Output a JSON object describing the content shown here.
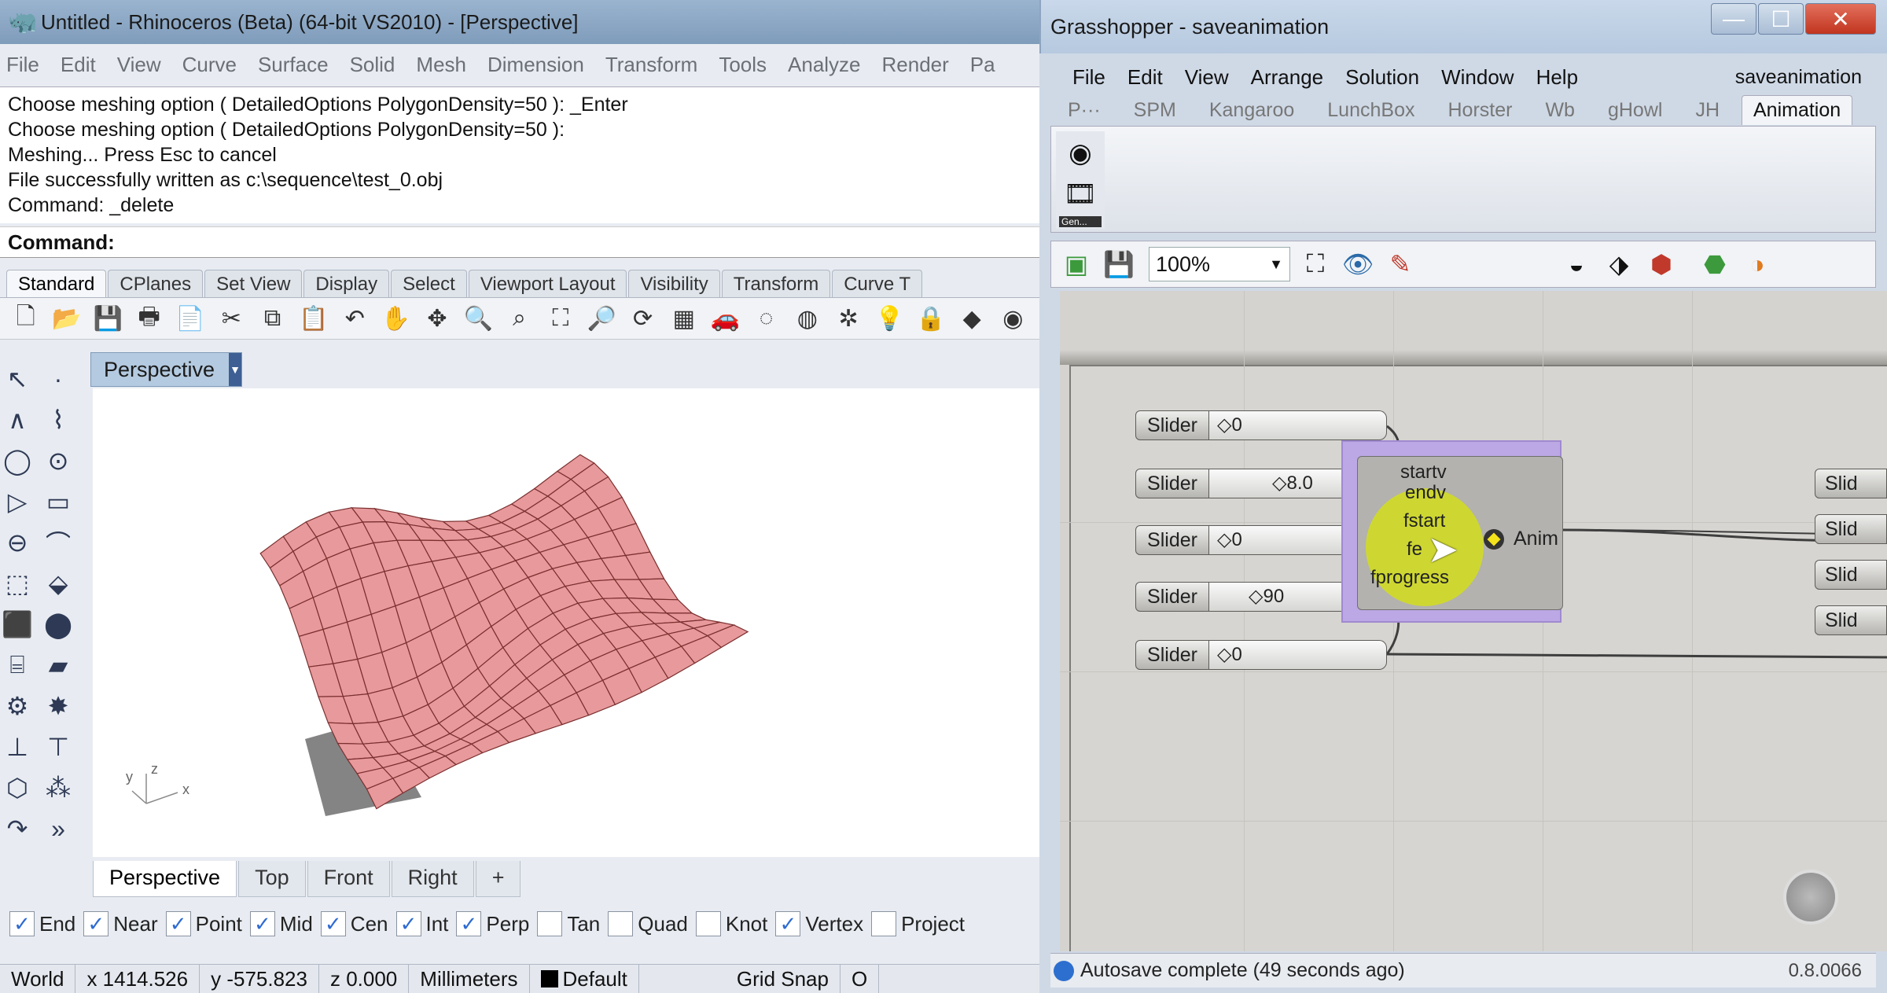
{
  "rhino": {
    "title": "Untitled - Rhinoceros (Beta) (64-bit VS2010) - [Perspective]",
    "menu": [
      "File",
      "Edit",
      "View",
      "Curve",
      "Surface",
      "Solid",
      "Mesh",
      "Dimension",
      "Transform",
      "Tools",
      "Analyze",
      "Render",
      "Pa"
    ],
    "history": [
      "Choose meshing option ( DetailedOptions  PolygonDensity=50 ): _Enter",
      "Choose meshing option ( DetailedOptions  PolygonDensity=50 ):",
      "Meshing... Press Esc to cancel",
      "File successfully written as c:\\sequence\\test_0.obj",
      "Command: _delete"
    ],
    "command_label": "Command:",
    "toolbar_tabs": [
      "Standard",
      "CPlanes",
      "Set View",
      "Display",
      "Select",
      "Viewport Layout",
      "Visibility",
      "Transform",
      "Curve T"
    ],
    "viewport_title": "Perspective",
    "viewport_tabs": [
      "Perspective",
      "Top",
      "Front",
      "Right"
    ],
    "viewport_add": "+",
    "axes": {
      "y": "y",
      "z": "z",
      "x": "x"
    },
    "osnaps": [
      {
        "label": "End",
        "checked": "✓"
      },
      {
        "label": "Near",
        "checked": "✓"
      },
      {
        "label": "Point",
        "checked": "✓"
      },
      {
        "label": "Mid",
        "checked": "✓"
      },
      {
        "label": "Cen",
        "checked": "✓"
      },
      {
        "label": "Int",
        "checked": "✓"
      },
      {
        "label": "Perp",
        "checked": "✓"
      },
      {
        "label": "Tan",
        "checked": ""
      },
      {
        "label": "Quad",
        "checked": ""
      },
      {
        "label": "Knot",
        "checked": ""
      },
      {
        "label": "Vertex",
        "checked": "✓"
      },
      {
        "label": "Project",
        "checked": ""
      }
    ],
    "status": {
      "cplane": "World",
      "x": "x 1414.526",
      "y": "y -575.823",
      "z": "z 0.000",
      "units": "Millimeters",
      "layer": "Default",
      "gridsnap": "Grid Snap",
      "more": "O"
    },
    "colors": {
      "surface": "#e8999b",
      "surface_edge": "#7a2f2f",
      "viewport_tab": "#b4cae0"
    }
  },
  "grasshopper": {
    "title": "Grasshopper - saveanimation",
    "window_buttons": {
      "minimize": "—",
      "maximize": "☐",
      "close": "✕"
    },
    "menu": [
      "File",
      "Edit",
      "View",
      "Arrange",
      "Solution",
      "Window",
      "Help"
    ],
    "document": "saveanimation",
    "tabs": [
      "P···",
      "SPM",
      "Kangaroo",
      "LunchBox",
      "Horster",
      "Wb",
      "gHowl",
      "JH",
      "Animation"
    ],
    "ribbon_caption": "Gen...",
    "zoom": "100%",
    "sliders": [
      {
        "label": "Slider",
        "value": "0"
      },
      {
        "label": "Slider",
        "value": "8.0"
      },
      {
        "label": "Slider",
        "value": "0"
      },
      {
        "label": "Slider",
        "value": "90"
      },
      {
        "label": "Slider",
        "value": "0"
      }
    ],
    "anim_component": {
      "inputs": [
        "startv",
        "endv",
        "fstart",
        "fe",
        "fprogress"
      ],
      "output": "Anim"
    },
    "right_sliders": [
      "Slid",
      "Slid",
      "Slid",
      "Slid"
    ],
    "status_message": "Autosave complete (49 seconds ago)",
    "version": "0.8.0066",
    "colors": {
      "canvas": "#d4d3cf",
      "anim_group": "#bba8e4",
      "highlight": "#d6e210"
    }
  }
}
